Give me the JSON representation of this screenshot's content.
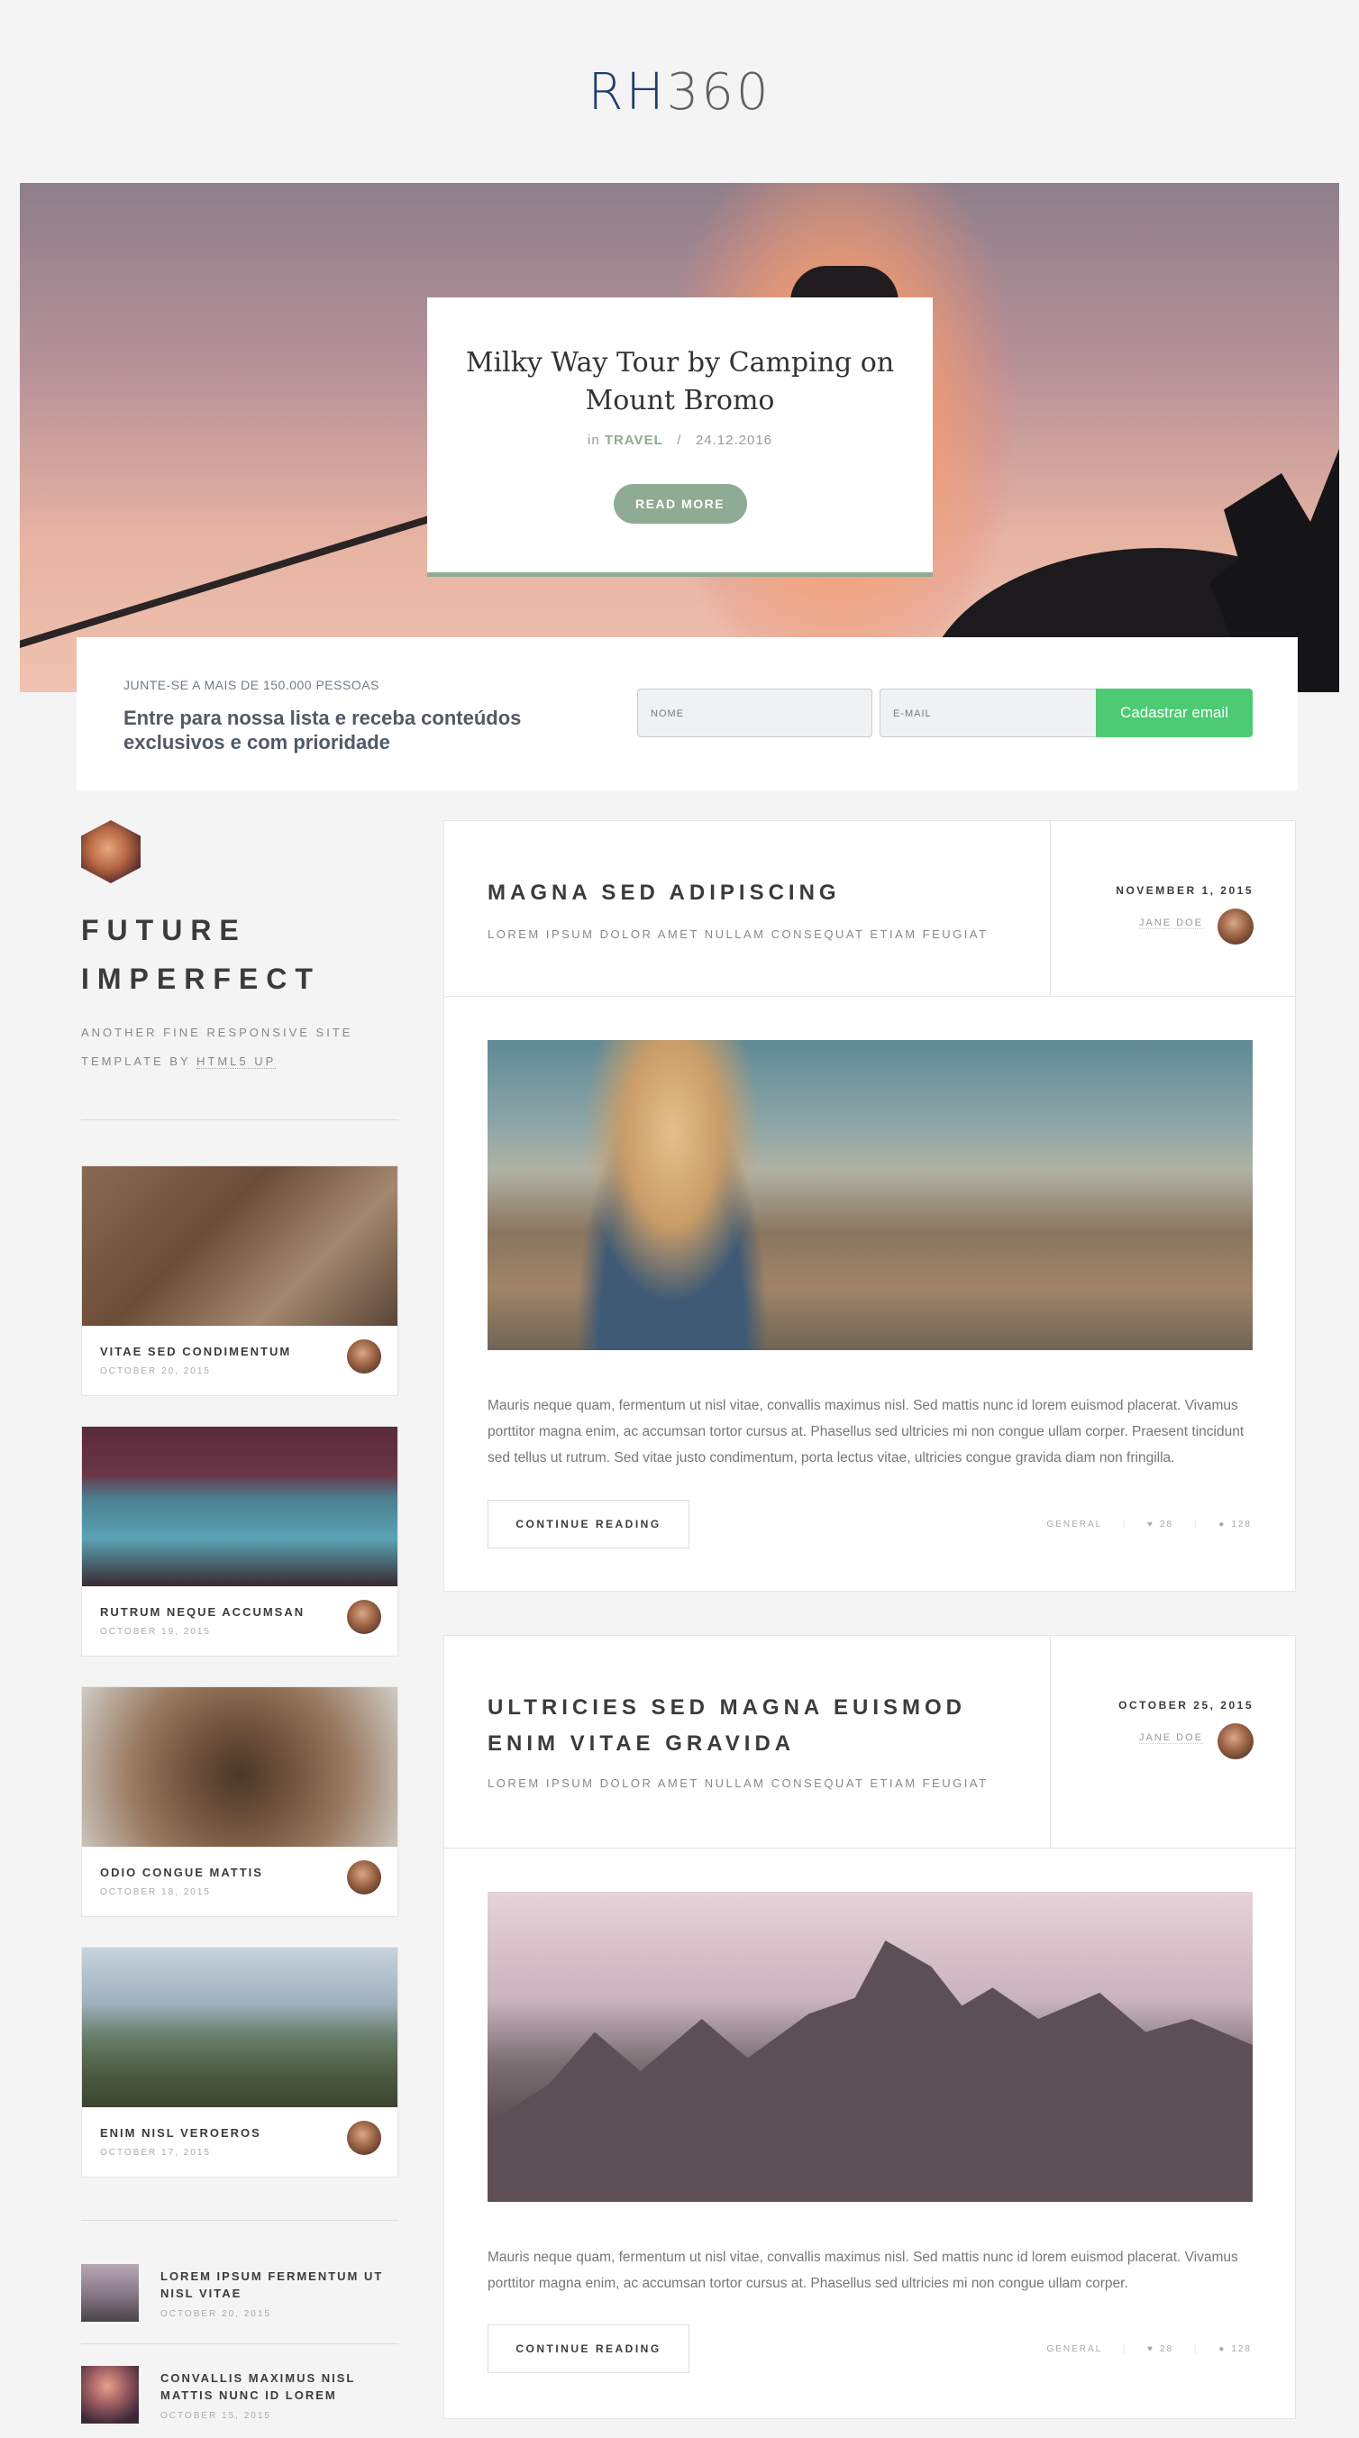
{
  "logo": {
    "part1": "RH",
    "part2": "360"
  },
  "hero": {
    "title": "Milky Way Tour by Camping on Mount Bromo",
    "meta_prefix": "in",
    "category": "TRAVEL",
    "separator": "/",
    "date": "24.12.2016",
    "button": "READ MORE"
  },
  "newsletter": {
    "kicker": "JUNTE-SE A MAIS DE 150.000 PESSOAS",
    "headline": "Entre para nossa lista e receba conteúdos exclusivos e com prioridade",
    "name_placeholder": "NOME",
    "email_placeholder": "E-MAIL",
    "submit": "Cadastrar email",
    "submit_color": "#4ccb73"
  },
  "sidebar": {
    "title_line1": "FUTURE",
    "title_line2": "IMPERFECT",
    "desc_line1": "ANOTHER FINE RESPONSIVE SITE",
    "desc_line2_prefix": "TEMPLATE BY",
    "desc_link": "HTML5 UP",
    "mini_posts": [
      {
        "title": "VITAE SED CONDIMENTUM",
        "date": "OCTOBER 20, 2015",
        "image": "workbench-tools"
      },
      {
        "title": "RUTRUM NEQUE ACCUMSAN",
        "date": "OCTOBER 19, 2015",
        "image": "blue-van"
      },
      {
        "title": "ODIO CONGUE MATTIS",
        "date": "OCTOBER 18, 2015",
        "image": "bear"
      },
      {
        "title": "ENIM NISL VEROEROS",
        "date": "OCTOBER 17, 2015",
        "image": "mountain-hiker"
      }
    ],
    "list_posts": [
      {
        "title": "LOREM IPSUM FERMENTUM UT NISL VITAE",
        "date": "OCTOBER 20, 2015"
      },
      {
        "title": "CONVALLIS MAXIMUS NISL MATTIS NUNC ID LOREM",
        "date": "OCTOBER 15, 2015"
      }
    ]
  },
  "posts": [
    {
      "title_line1": "MAGNA SED ADIPISCING",
      "title_line2": "",
      "subtitle": "LOREM IPSUM DOLOR AMET NULLAM CONSEQUAT ETIAM FEUGIAT",
      "date": "NOVEMBER 1, 2015",
      "author": "JANE DOE",
      "body": "Mauris neque quam, fermentum ut nisl vitae, convallis maximus nisl. Sed mattis nunc id lorem euismod placerat. Vivamus porttitor magna enim, ac accumsan tortor cursus at. Phasellus sed ultricies mi non congue ullam corper. Praesent tincidunt sed tellus ut rutrum. Sed vitae justo condimentum, porta lectus vitae, ultricies congue gravida diam non fringilla.",
      "button": "CONTINUE READING",
      "category": "GENERAL",
      "likes": "28",
      "comments": "128"
    },
    {
      "title_line1": "ULTRICIES SED MAGNA EUISMOD",
      "title_line2": "ENIM VITAE GRAVIDA",
      "subtitle": "LOREM IPSUM DOLOR AMET NULLAM CONSEQUAT ETIAM FEUGIAT",
      "date": "OCTOBER 25, 2015",
      "author": "JANE DOE",
      "body": "Mauris neque quam, fermentum ut nisl vitae, convallis maximus nisl. Sed mattis nunc id lorem euismod placerat. Vivamus porttitor magna enim, ac accumsan tortor cursus at. Phasellus sed ultricies mi non congue ullam corper.",
      "button": "CONTINUE READING",
      "category": "GENERAL",
      "likes": "28",
      "comments": "128"
    }
  ],
  "icons": {
    "like": "heart-icon",
    "comment": "comment-icon"
  },
  "colors": {
    "accent": "#8fab93",
    "brand": "#1f3e6e"
  }
}
